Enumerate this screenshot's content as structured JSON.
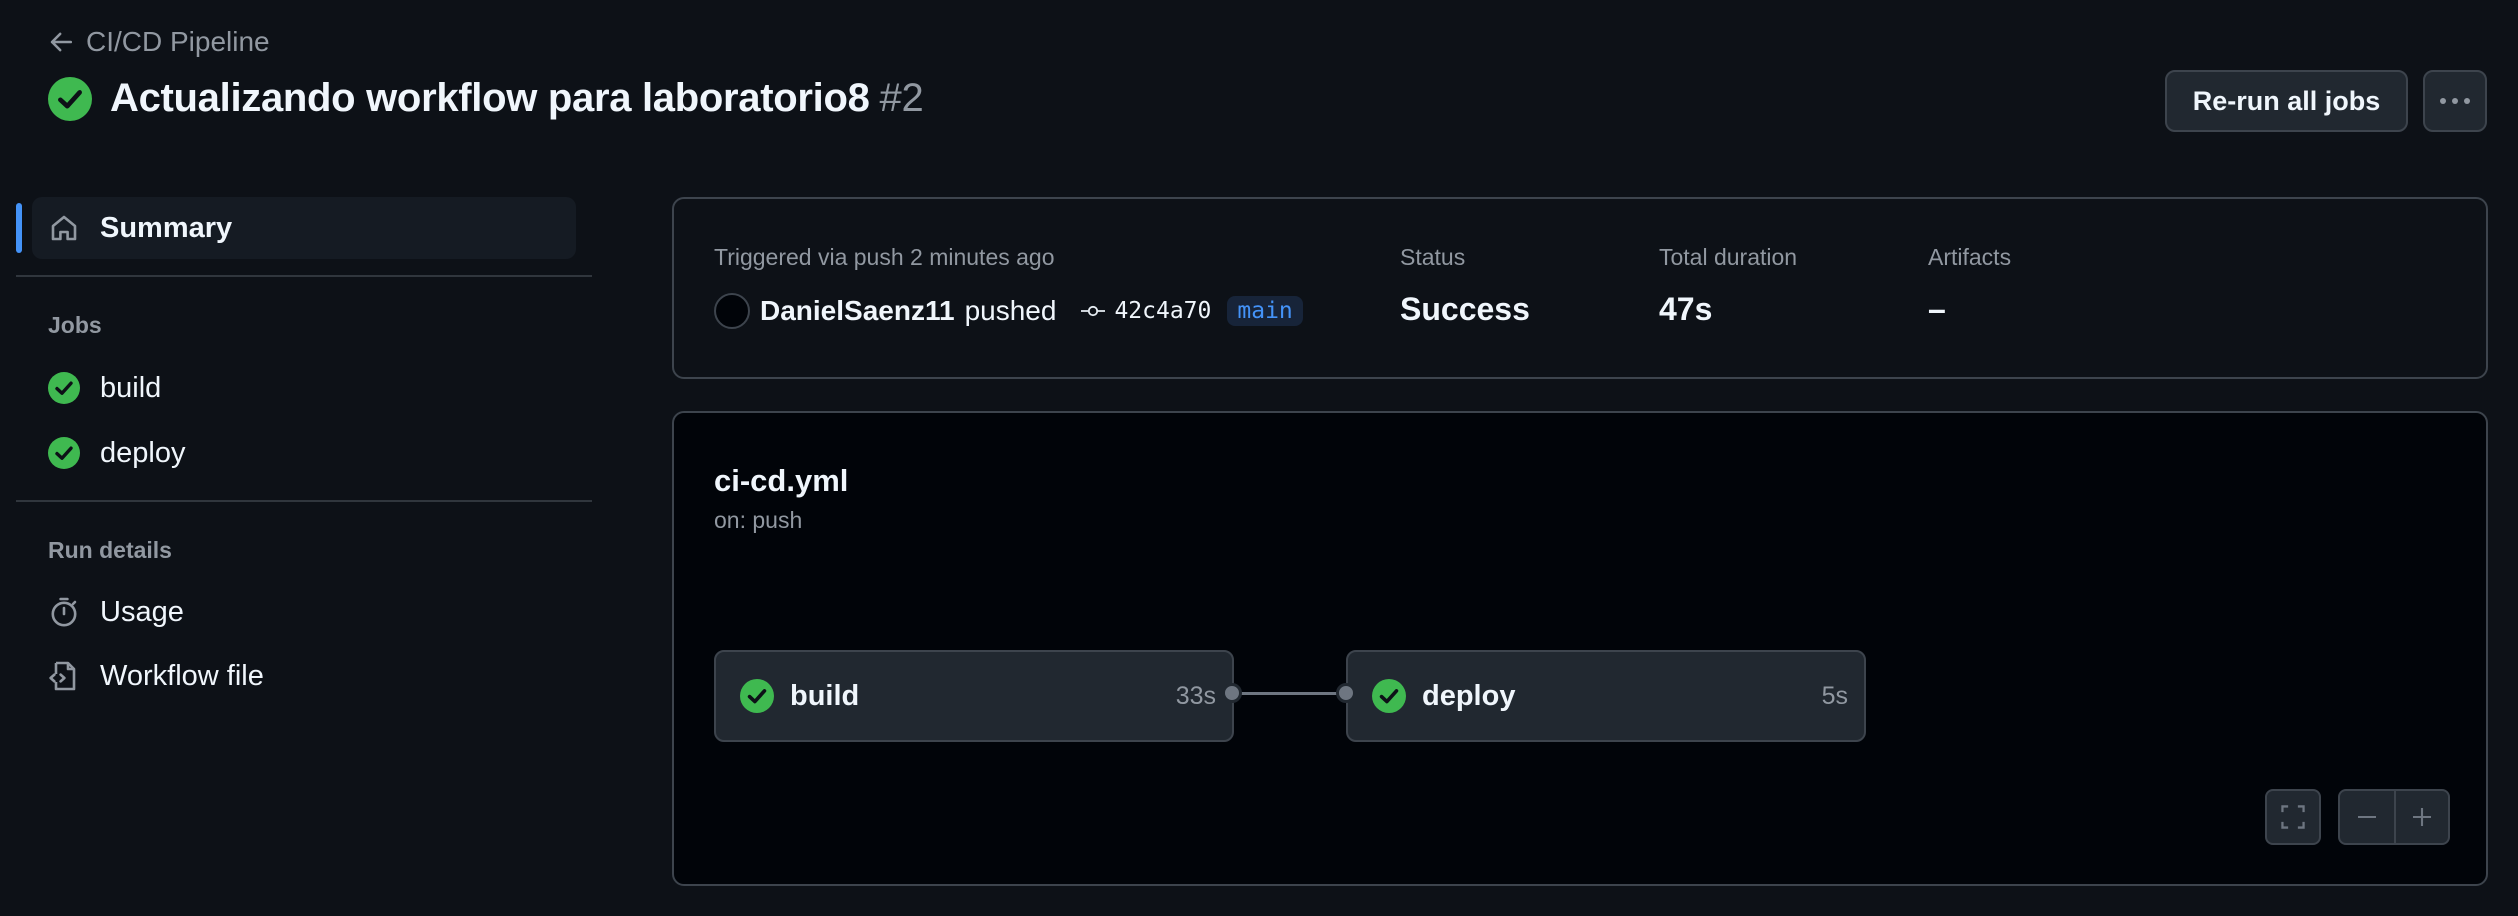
{
  "header": {
    "back_label": "CI/CD Pipeline",
    "title": "Actualizando workflow para laboratorio8",
    "run_number": "#2",
    "rerun_label": "Re-run all jobs"
  },
  "sidebar": {
    "summary_label": "Summary",
    "jobs_heading": "Jobs",
    "jobs": [
      {
        "label": "build",
        "status": "success"
      },
      {
        "label": "deploy",
        "status": "success"
      }
    ],
    "run_details_heading": "Run details",
    "details": [
      {
        "label": "Usage",
        "icon": "stopwatch-icon"
      },
      {
        "label": "Workflow file",
        "icon": "file-code-icon"
      }
    ]
  },
  "summary": {
    "trigger_text": "Triggered via push 2 minutes ago",
    "actor": "DanielSaenz11",
    "action": "pushed",
    "commit": "42c4a70",
    "branch": "main",
    "status_label": "Status",
    "status_value": "Success",
    "duration_label": "Total duration",
    "duration_value": "47s",
    "artifacts_label": "Artifacts",
    "artifacts_value": "–"
  },
  "workflow": {
    "file": "ci-cd.yml",
    "trigger": "on: push",
    "jobs": [
      {
        "name": "build",
        "duration": "33s"
      },
      {
        "name": "deploy",
        "duration": "5s"
      }
    ]
  },
  "colors": {
    "background": "#0d1117",
    "success": "#3fb950",
    "accent": "#4493f8",
    "border": "#3d444d"
  }
}
